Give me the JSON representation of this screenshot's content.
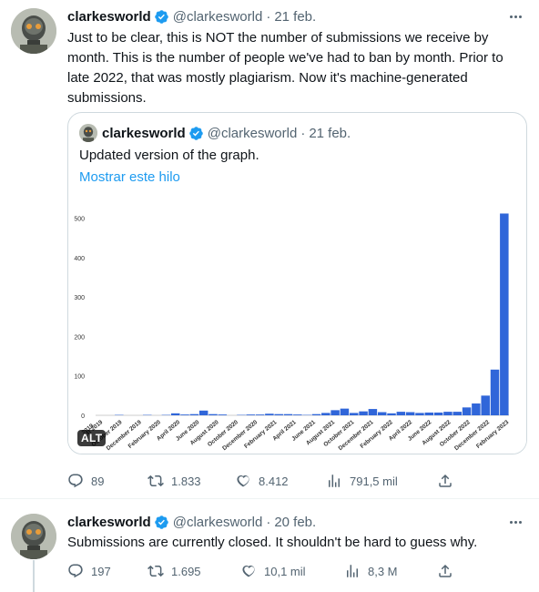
{
  "tweet1": {
    "author": {
      "name": "clarkesworld",
      "handle": "@clarkesworld",
      "dot": "·",
      "date": "21 feb."
    },
    "text": "Just to be clear, this is NOT the number of submissions we receive by month. This is the number of people we've had to ban by month. Prior to late 2022, that was mostly plagiarism. Now it's machine-generated submissions.",
    "quote": {
      "author": {
        "name": "clarkesworld",
        "handle": "@clarkesworld",
        "dot": "·",
        "date": "21 feb."
      },
      "text": "Updated version of the graph.",
      "link": "Mostrar este hilo",
      "alt_badge": "ALT"
    },
    "actions": {
      "replies": "89",
      "retweets": "1.833",
      "likes": "8.412",
      "views": "791,5 mil"
    }
  },
  "tweet2": {
    "author": {
      "name": "clarkesworld",
      "handle": "@clarkesworld",
      "dot": "·",
      "date": "20 feb."
    },
    "text": "Submissions are currently closed. It shouldn't be hard to guess why.",
    "actions": {
      "replies": "197",
      "retweets": "1.695",
      "likes": "10,1 mil",
      "views": "8,3 M"
    }
  },
  "colors": {
    "bar": "#3066d9",
    "link": "#1d9bf0",
    "verified": "#1d9bf0",
    "muted": "#536471"
  },
  "chart_data": {
    "type": "bar",
    "ylim": [
      0,
      520
    ],
    "y_ticks": [
      0,
      100,
      200,
      300,
      400,
      500
    ],
    "categories": [
      "Aug 2019",
      "Sep 2019",
      "Oct 2019",
      "Nov 2019",
      "Dec 2019",
      "Jan 2020",
      "Feb 2020",
      "Mar 2020",
      "Apr 2020",
      "May 2020",
      "Jun 2020",
      "Jul 2020",
      "Aug 2020",
      "Sep 2020",
      "Oct 2020",
      "Nov 2020",
      "Dec 2020",
      "Jan 2021",
      "Feb 2021",
      "Mar 2021",
      "Apr 2021",
      "May 2021",
      "Jun 2021",
      "Jul 2021",
      "Aug 2021",
      "Sep 2021",
      "Oct 2021",
      "Nov 2021",
      "Dec 2021",
      "Jan 2022",
      "Feb 2022",
      "Mar 2022",
      "Apr 2022",
      "May 2022",
      "Jun 2022",
      "Jul 2022",
      "Aug 2022",
      "Sep 2022",
      "Oct 2022",
      "Nov 2022",
      "Dec 2022",
      "Jan 2023",
      "Feb 2023"
    ],
    "values": [
      0,
      0,
      1,
      0,
      0,
      1,
      0,
      1,
      5,
      2,
      3,
      12,
      3,
      2,
      0,
      1,
      2,
      2,
      4,
      3,
      3,
      2,
      1,
      3,
      6,
      13,
      17,
      6,
      10,
      16,
      8,
      5,
      9,
      8,
      6,
      7,
      7,
      9,
      9,
      20,
      30,
      50,
      116,
      512
    ],
    "tick_labels": [
      "2019",
      "October 2019",
      "December 2019",
      "February 2020",
      "April 2020",
      "June 2020",
      "August 2020",
      "October 2020",
      "December 2020",
      "February 2021",
      "April 2021",
      "June 2021",
      "August 2021",
      "October 2021",
      "December 2021",
      "February 2022",
      "April 2022",
      "June 2022",
      "August 2022",
      "October 2022",
      "December 2022",
      "February 2023"
    ],
    "first_tick_partial": "ust 2019"
  }
}
